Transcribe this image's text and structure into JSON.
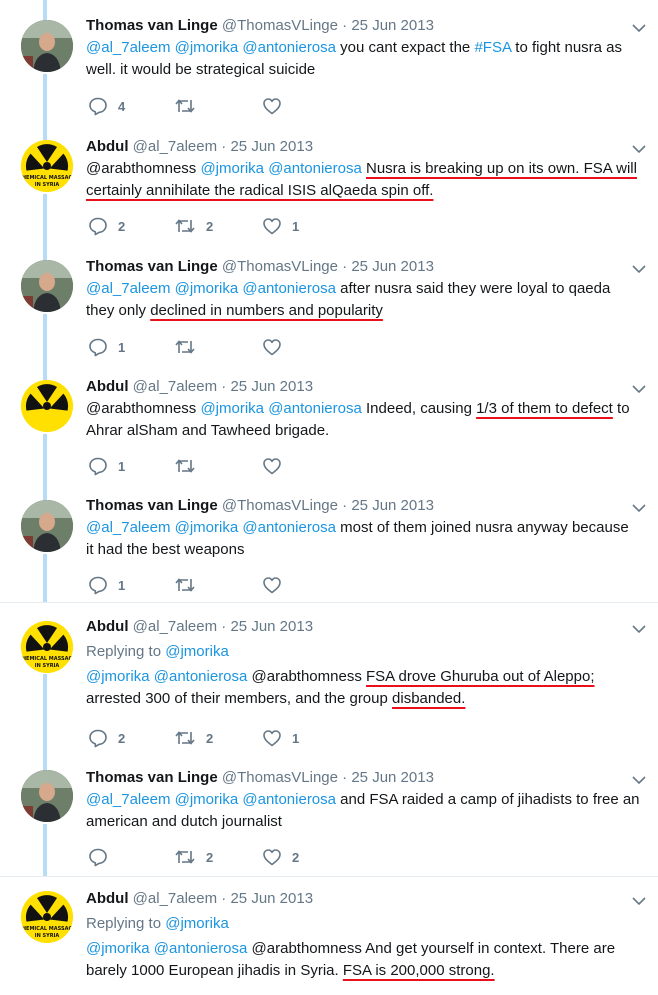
{
  "colors": {
    "link": "#1b95e0",
    "meta": "#657786",
    "underline": "#e8101c",
    "thread": "#b7dcf5"
  },
  "tweets": [
    {
      "name": "Thomas van Linge",
      "handle": "@ThomasVLinge",
      "sep": " · ",
      "date": "25 Jun 2013",
      "avatar": "profile-photo",
      "text": [
        "@al_7aleem",
        "@jmorika",
        "@antonierosa",
        "you cant expact the",
        "#FSA",
        "to fight nusra as well. it would be strategical suicide"
      ],
      "replies": "4",
      "retweets": "",
      "likes": ""
    },
    {
      "name": "Abdul",
      "handle": "@al_7aleem",
      "sep": " · ",
      "date": "25 Jun 2013",
      "avatar": "radiation-logo",
      "text": [
        "@arabthomness",
        "@jmorika",
        "@antonierosa",
        "Nusra is breaking up on its own. FSA will",
        "certainly annihilate the radical ISIS alQaeda spin off."
      ],
      "replies": "2",
      "retweets": "2",
      "likes": "1"
    },
    {
      "name": "Thomas van Linge",
      "handle": "@ThomasVLinge",
      "sep": " · ",
      "date": "25 Jun 2013",
      "avatar": "profile-photo",
      "text": [
        "@al_7aleem",
        "@jmorika",
        "@antonierosa",
        "after nusra said they were loyal to qaeda they only",
        "declined in numbers and popularity"
      ],
      "replies": "1",
      "retweets": "",
      "likes": ""
    },
    {
      "name": "Abdul",
      "handle": "@al_7aleem",
      "sep": " · ",
      "date": "25 Jun 2013",
      "avatar": "radiation-logo",
      "text": [
        "@arabthomness",
        "@jmorika",
        "@antonierosa",
        "Indeed, causing",
        "1/3 of them to defect",
        "to Ahrar alSham and Tawheed brigade."
      ],
      "replies": "1",
      "retweets": "",
      "likes": ""
    },
    {
      "name": "Thomas van Linge",
      "handle": "@ThomasVLinge",
      "sep": " · ",
      "date": "25 Jun 2013",
      "avatar": "profile-photo",
      "text": [
        "@al_7aleem",
        "@jmorika",
        "@antonierosa",
        "most of them joined nusra anyway because it had the best weapons"
      ],
      "replies": "1",
      "retweets": "",
      "likes": ""
    },
    {
      "name": "Abdul",
      "handle": "@al_7aleem",
      "sep": " · ",
      "date": "25 Jun 2013",
      "avatar": "radiation-logo",
      "replying": {
        "label": "Replying to",
        "to": "@jmorika"
      },
      "text": [
        "@jmorika",
        "@antonierosa",
        "@arabthomness",
        "FSA drove Ghuruba out of Aleppo;",
        "arrested 300 of their members, and the group",
        "disbanded."
      ],
      "replies": "2",
      "retweets": "2",
      "likes": "1"
    },
    {
      "name": "Thomas van Linge",
      "handle": "@ThomasVLinge",
      "sep": " · ",
      "date": "25 Jun 2013",
      "avatar": "profile-photo",
      "text": [
        "@al_7aleem",
        "@jmorika",
        "@antonierosa",
        "and FSA raided a camp of jihadists to free an american and dutch journalist"
      ],
      "replies": "",
      "retweets": "2",
      "likes": "2"
    },
    {
      "name": "Abdul",
      "handle": "@al_7aleem",
      "sep": " · ",
      "date": "25 Jun 2013",
      "avatar": "radiation-logo",
      "replying": {
        "label": "Replying to",
        "to": "@jmorika"
      },
      "text": [
        "@jmorika",
        "@antonierosa",
        "@arabthomness",
        "And get yourself in context. There are barely 1000 European jihadis in Syria.",
        "FSA is 200,000 strong."
      ],
      "replies": "",
      "retweets": "",
      "likes": ""
    }
  ]
}
